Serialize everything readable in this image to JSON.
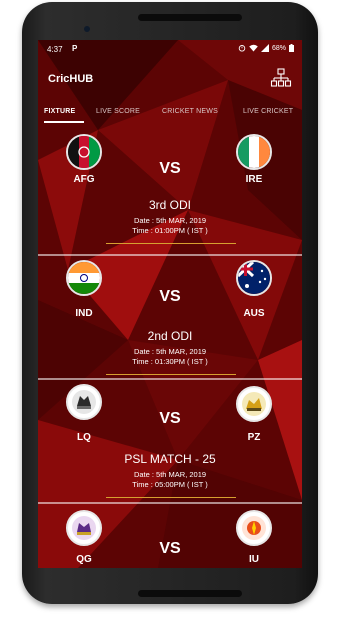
{
  "status_bar": {
    "time": "4:37",
    "notification_icon": "P",
    "battery_percent": "68%",
    "icons": [
      "alarm-icon",
      "wifi-icon",
      "signal-icon",
      "battery-icon"
    ]
  },
  "app": {
    "title": "CricHUB",
    "menu_icon": "hierarchy-icon",
    "accent": "#b30f0f",
    "background": "#5a0303"
  },
  "tabs": [
    {
      "label": "FIXTURE",
      "active": true
    },
    {
      "label": "LIVE SCORE",
      "active": false
    },
    {
      "label": "CRICKET NEWS",
      "active": false
    },
    {
      "label": "LIVE CRICKET",
      "active": false
    }
  ],
  "matches": [
    {
      "team1": "AFG",
      "team2": "IRE",
      "vs": "VS",
      "title": "3rd ODI",
      "date": "Date : 5th MAR, 2019",
      "time": "Time : 01:00PM ( IST )"
    },
    {
      "team1": "IND",
      "team2": "AUS",
      "vs": "VS",
      "title": "2nd ODI",
      "date": "Date : 5th MAR, 2019",
      "time": "Time : 01:30PM ( IST )"
    },
    {
      "team1": "LQ",
      "team2": "PZ",
      "vs": "VS",
      "title": "PSL MATCH - 25",
      "date": "Date : 5th MAR, 2019",
      "time": "Time : 05:00PM ( IST )"
    },
    {
      "team1": "QG",
      "team2": "IU",
      "vs": "VS",
      "title": "",
      "date": "",
      "time": ""
    }
  ]
}
